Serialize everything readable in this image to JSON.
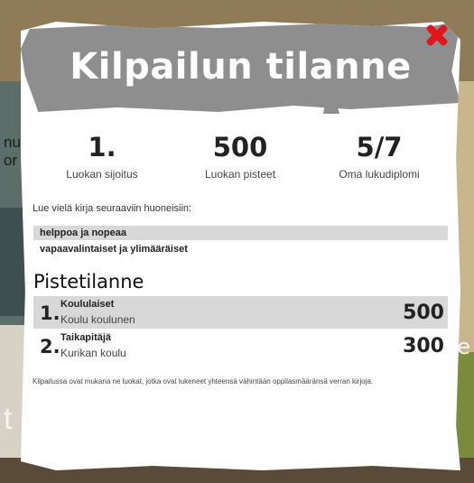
{
  "background_side_texts": {
    "left_top": "nu",
    "left_mid": "or",
    "left_bottom": "t",
    "right_mid": "ie"
  },
  "modal": {
    "title": "Kilpailun tilanne",
    "close_icon": "close-x-icon",
    "stats": [
      {
        "value": "1.",
        "label": "Luokan sijoitus"
      },
      {
        "value": "500",
        "label": "Luokan pisteet"
      },
      {
        "value": "5/7",
        "label": "Oma lukudiplomi"
      }
    ],
    "rooms_prompt": "Lue vielä kirja seuraaviin huoneisiin:",
    "rooms": [
      "helppoa ja nopeaa",
      "vapaavalintaiset ja ylimääräiset"
    ],
    "standings_title": "Pistetilanne",
    "standings": [
      {
        "rank": "1.",
        "name": "Koululaiset",
        "school": "Koulu koulunen",
        "points": "500"
      },
      {
        "rank": "2.",
        "name": "Taikapitäjä",
        "school": "Kurikan koulu",
        "points": "300"
      }
    ],
    "note": "Kilpailussa ovat mukana ne luokat, jotka ovat lukeneet yhteensä vähintään oppilasmääränsä verran kirjoja."
  },
  "colors": {
    "header_gray": "#8e8e8e",
    "close_red": "#e0161c",
    "row_shade": "#d8d8d8"
  }
}
